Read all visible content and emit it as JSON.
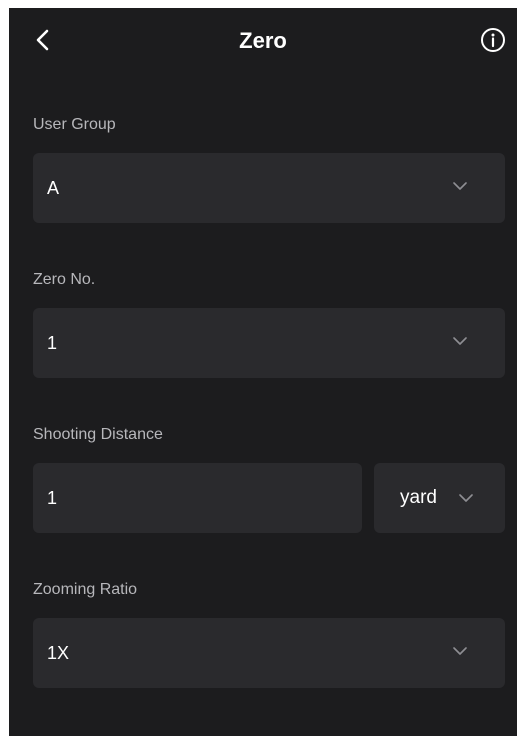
{
  "header": {
    "title": "Zero",
    "back_icon": "chevron-left-icon",
    "info_icon": "info-circle-icon"
  },
  "user_group": {
    "label": "User Group",
    "value": "A"
  },
  "zero_no": {
    "label": "Zero No.",
    "value": "1"
  },
  "shooting_distance": {
    "label": "Shooting Distance",
    "value": "1",
    "unit": "yard"
  },
  "zooming_ratio": {
    "label": "Zooming Ratio",
    "value": "1X"
  },
  "colors": {
    "background": "#1c1c1e",
    "field": "#2a2a2d",
    "label": "#b7b7bb",
    "text": "#ffffff",
    "chevron": "#8e8e93"
  }
}
